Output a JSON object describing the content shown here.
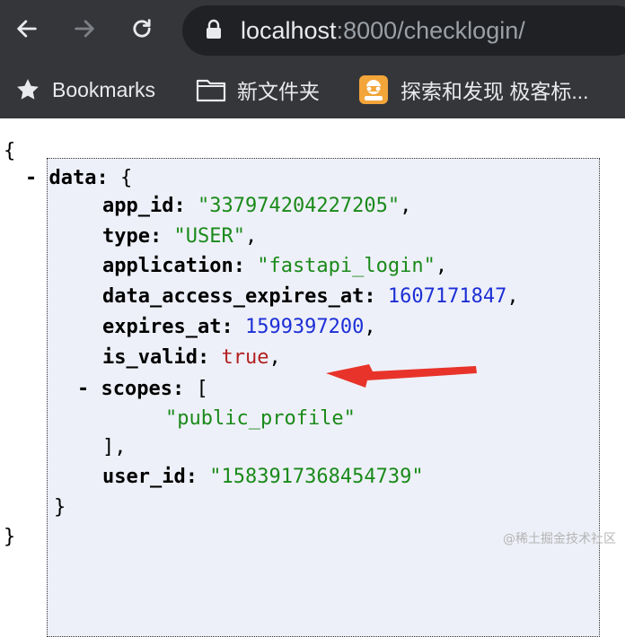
{
  "browser": {
    "url": {
      "host": "localhost",
      "rest": ":8000/checklogin/"
    }
  },
  "bookmarks_bar": {
    "items": [
      {
        "label": "Bookmarks",
        "icon": "star-icon"
      },
      {
        "label": "新文件夹",
        "icon": "folder-icon"
      },
      {
        "label": "探索和发现 极客标...",
        "icon": "site-favicon"
      }
    ]
  },
  "json_view": {
    "open_brace": "{",
    "close_brace": "}",
    "collapse_marker": "-",
    "data_key": "data",
    "data_open": "{",
    "data_close": "}",
    "fields": [
      {
        "key": "app_id",
        "value": "\"337974204227205\"",
        "type": "string"
      },
      {
        "key": "type",
        "value": "\"USER\"",
        "type": "string"
      },
      {
        "key": "application",
        "value": "\"fastapi_login\"",
        "type": "string"
      },
      {
        "key": "data_access_expires_at",
        "value": "1607171847",
        "type": "number"
      },
      {
        "key": "expires_at",
        "value": "1599397200",
        "type": "number"
      },
      {
        "key": "is_valid",
        "value": "true",
        "type": "boolean"
      }
    ],
    "scopes": {
      "key": "scopes",
      "open": "[",
      "items": [
        "\"public_profile\""
      ],
      "close": "],"
    },
    "user_id": {
      "key": "user_id",
      "value": "\"1583917368454739\""
    }
  },
  "annotation": {
    "arrow_color": "#e8332a"
  },
  "watermark": "@稀土掘金技术社区",
  "colors": {
    "string": "#1a8a1a",
    "number": "#1c2fd6",
    "boolean": "#b22020",
    "chrome_bg": "#35363a",
    "omnibox_bg": "#202124"
  }
}
